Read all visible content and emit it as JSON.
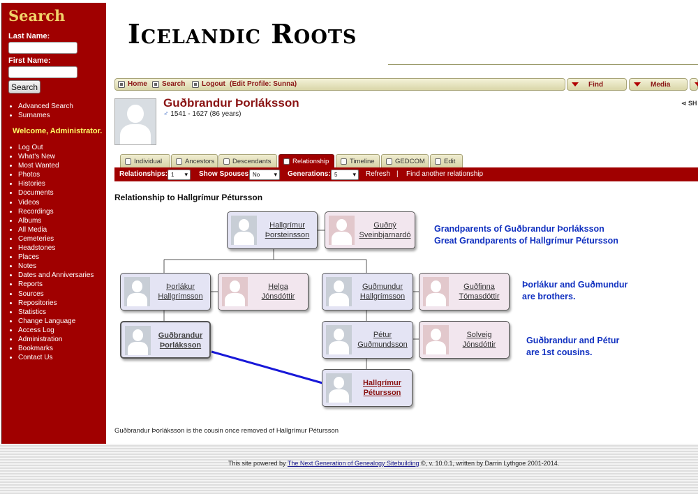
{
  "sidebar": {
    "search_title": "Search",
    "last_name_label": "Last Name:",
    "first_name_label": "First Name:",
    "last_name_value": "",
    "first_name_value": "",
    "search_button": "Search",
    "links1": [
      "Advanced Search",
      "Surnames"
    ],
    "welcome": "Welcome, Administrator.",
    "links2": [
      "Log Out",
      "What's New",
      "Most Wanted",
      "Photos",
      "Histories",
      "Documents",
      "Videos",
      "Recordings",
      "Albums",
      "All Media",
      "Cemeteries",
      "Headstones",
      "Places",
      "Notes",
      "Dates and Anniversaries",
      "Reports",
      "Sources",
      "Repositories",
      "Statistics",
      "Change Language",
      "Access Log",
      "Administration",
      "Bookmarks",
      "Contact Us"
    ]
  },
  "header": {
    "site_title": "Icelandic Roots"
  },
  "topnav": {
    "home": "Home",
    "search": "Search",
    "logout": "Logout",
    "edit_profile": "(Edit Profile: Sunna)",
    "find": "Find",
    "media": "Media"
  },
  "person": {
    "name": "Guðbrandur Þorláksson",
    "gender_symbol": "♂",
    "dates": "1541 - 1627  (86 years)",
    "share": "SH"
  },
  "tabs": [
    "Individual",
    "Ancestors",
    "Descendants",
    "Relationship",
    "Timeline",
    "GEDCOM",
    "Edit"
  ],
  "subbar": {
    "relationships_label": "Relationships:",
    "relationships_value": "1",
    "spouses_label": "Show Spouses:",
    "spouses_value": "No",
    "generations_label": "Generations:",
    "generations_value": "5",
    "refresh": "Refresh",
    "separator": "|",
    "find_another": "Find another relationship"
  },
  "relationship": {
    "heading": "Relationship to Hallgrímur Pétursson",
    "boxes": {
      "b1": [
        "Hallgrímur",
        "Þorsteinsson"
      ],
      "b2": [
        "Guðný",
        "Sveinbjarnardó"
      ],
      "b3": [
        "Þorlákur",
        "Hallgrímsson"
      ],
      "b4": [
        "Helga",
        "Jónsdóttir"
      ],
      "b5": [
        "Guðmundur",
        "Hallgrímsson"
      ],
      "b6": [
        "Guðfinna",
        "Tómasdóttir"
      ],
      "b7": [
        "Guðbrandur",
        "Þorláksson"
      ],
      "b8": [
        "Pétur",
        "Guðmundsson"
      ],
      "b9": [
        "Solveig",
        "Jónsdóttir"
      ],
      "b10": [
        "Hallgrímur",
        "Pétursson"
      ]
    },
    "note1": [
      "Grandparents of Guðbrandur Þorláksson",
      "Great Grandparents of Hallgrímur Pétursson"
    ],
    "note2": [
      "Þorlákur and Guðmundur",
      "are brothers."
    ],
    "note3": [
      "Guðbrandur and Pétur",
      "are 1st cousins."
    ],
    "summary": "Guðbrandur Þorláksson is the cousin once removed of Hallgrímur Pétursson"
  },
  "footer": {
    "prefix": "This site powered by",
    "link": "The Next Generation of Genealogy Sitebuilding",
    "suffix": "©, v. 10.0.1, written by Darrin Lythgoe 2001-2014."
  },
  "colors": {
    "sidebar": "#a00000",
    "accent_red": "#8a1414",
    "note_blue": "#1030c0",
    "title_gold": "#f1d36a"
  }
}
